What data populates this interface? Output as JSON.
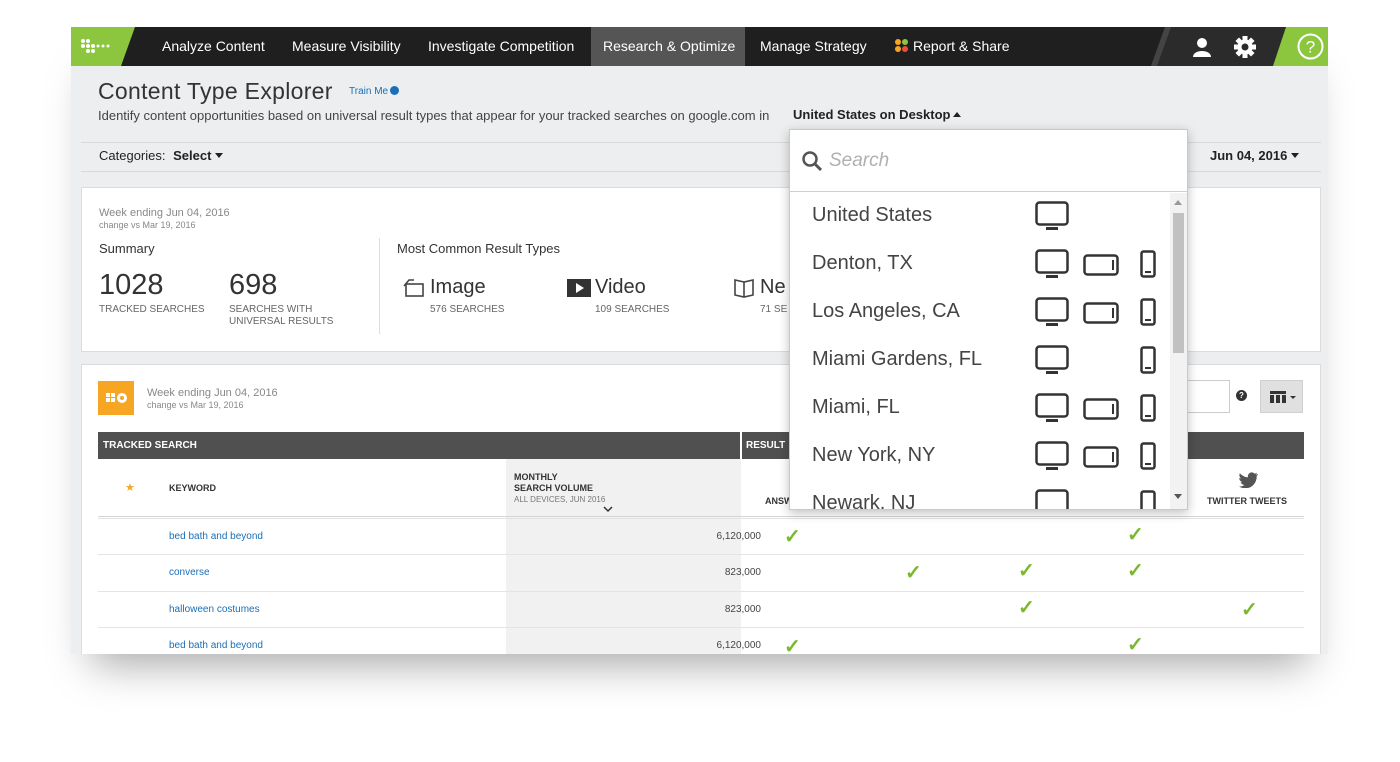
{
  "nav": {
    "items": [
      {
        "label": "Analyze Content"
      },
      {
        "label": "Measure Visibility"
      },
      {
        "label": "Investigate Competition"
      },
      {
        "label": "Research & Optimize",
        "active": true
      },
      {
        "label": "Manage Strategy"
      },
      {
        "label": "Report & Share"
      }
    ],
    "icons": [
      "logo-icon",
      "user-icon",
      "gear-icon",
      "help-icon"
    ],
    "accent_color": "#8cc63f"
  },
  "header": {
    "title": "Content Type Explorer",
    "train_me": "Train Me",
    "subtitle": "Identify content opportunities based on universal result types that appear for your tracked searches on google.com in",
    "locale": "United States on Desktop"
  },
  "filters": {
    "categories_label": "Categories:",
    "categories_value": "Select",
    "date": "Jun 04, 2016"
  },
  "summary": {
    "week": "Week ending Jun 04, 2016",
    "change": "change vs Mar 19, 2016",
    "heading": "Summary",
    "tracked_count": "1028",
    "tracked_label": "TRACKED SEARCHES",
    "universal_count": "698",
    "universal_label_1": "SEARCHES WITH",
    "universal_label_2": "UNIVERSAL RESULTS",
    "common_heading": "Most Common Result Types",
    "result_types": [
      {
        "name": "Image",
        "count": "576 SEARCHES"
      },
      {
        "name": "Video",
        "count": "109 SEARCHES"
      },
      {
        "name": "Ne",
        "count": "71 SE"
      }
    ]
  },
  "table_section": {
    "week": "Week ending Jun 04, 2016",
    "change": "change vs Mar 19, 2016",
    "group_headers": [
      "TRACKED SEARCH",
      "RESULT"
    ],
    "col_keyword": "KEYWORD",
    "col_volume_1": "MONTHLY",
    "col_volume_2": "SEARCH VOLUME",
    "col_volume_3": "ALL DEVICES, JUN 2016",
    "col_answers": "ANSW",
    "col_twitter": "TWITTER TWEETS",
    "rows": [
      {
        "keyword": "bed bath and beyond",
        "volume": "6,120,000"
      },
      {
        "keyword": "converse",
        "volume": "823,000"
      },
      {
        "keyword": "halloween costumes",
        "volume": "823,000"
      },
      {
        "keyword": "bed bath and beyond",
        "volume": "6,120,000"
      }
    ]
  },
  "dropdown": {
    "placeholder": "Search",
    "items": [
      {
        "label": "United States",
        "devices": [
          "desktop"
        ]
      },
      {
        "label": "Denton, TX",
        "devices": [
          "desktop",
          "tablet",
          "mobile"
        ]
      },
      {
        "label": "Los Angeles, CA",
        "devices": [
          "desktop",
          "tablet",
          "mobile"
        ]
      },
      {
        "label": "Miami Gardens, FL",
        "devices": [
          "desktop",
          "mobile"
        ]
      },
      {
        "label": "Miami, FL",
        "devices": [
          "desktop",
          "tablet",
          "mobile"
        ]
      },
      {
        "label": "New York, NY",
        "devices": [
          "desktop",
          "tablet",
          "mobile"
        ]
      },
      {
        "label": "Newark, NJ",
        "devices": [
          "desktop",
          "mobile"
        ]
      }
    ]
  }
}
